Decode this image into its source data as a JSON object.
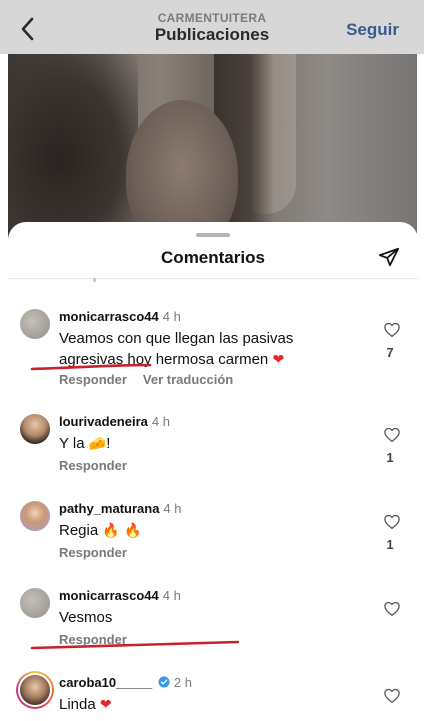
{
  "header": {
    "account": "CARMENTUITERA",
    "title": "Publicaciones",
    "follow_label": "Seguir",
    "back_icon": "chevron-left-icon"
  },
  "sheet": {
    "title": "Comentarios",
    "share_icon": "paper-plane-icon"
  },
  "comments": [
    {
      "user": "monicarrasco44",
      "time": "4 h",
      "text_line1": "Veamos con que llegan las pasivas",
      "text_line2": "agresivas hoy hermosa carmen",
      "emoji": "❤",
      "reply_label": "Responder",
      "translate_label": "Ver traducción",
      "likes": "7"
    },
    {
      "user": "lourivadeneira",
      "time": "4 h",
      "text": "Y la",
      "emoji": "🧀",
      "text_suffix": "!",
      "reply_label": "Responder",
      "likes": "1"
    },
    {
      "user": "pathy_maturana",
      "time": "4 h",
      "text": "Regia",
      "emoji": "🔥 🔥",
      "reply_label": "Responder",
      "likes": "1"
    },
    {
      "user": "monicarrasco44",
      "time": "4 h",
      "text": "Vesmos",
      "reply_label": "Responder",
      "likes": ""
    },
    {
      "user": "caroba10_____",
      "time": "2 h",
      "verified": true,
      "text": "Linda",
      "emoji": "❤"
    }
  ],
  "colors": {
    "accent_link": "#3b5a8f",
    "annotation_red": "#c8232c",
    "heart": "#e3262f"
  }
}
